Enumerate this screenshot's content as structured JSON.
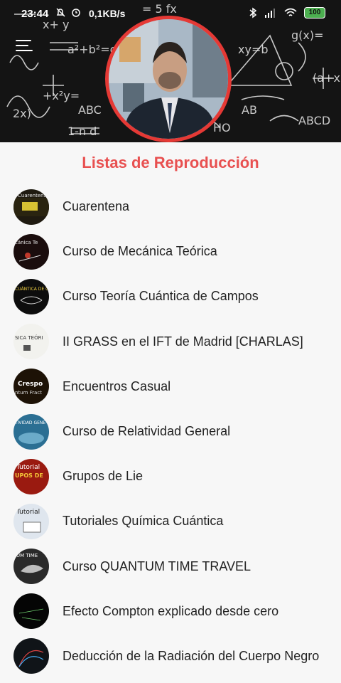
{
  "status_bar": {
    "time": "23:44",
    "speed": "0,1KB/s",
    "battery": "100",
    "icons": [
      "bell-off-icon",
      "alarm-icon",
      "bluetooth-icon",
      "signal-icon",
      "wifi-icon",
      "battery-icon"
    ]
  },
  "header": {
    "menu_icon": "hamburger-menu-icon",
    "avatar": "profile-photo"
  },
  "colors": {
    "accent": "#e85050",
    "ring": "#e53935",
    "background": "#f7f7f7"
  },
  "section_title": "Listas de Reproducción",
  "playlists": [
    {
      "label": "Cuarentena",
      "thumb_color": "#1f1a10"
    },
    {
      "label": "Curso de Mecánica Teórica",
      "thumb_color": "#1a0d0d"
    },
    {
      "label": "Curso Teoría Cuántica de Campos",
      "thumb_color": "#0d0d0d"
    },
    {
      "label": "II GRASS en el IFT de Madrid [CHARLAS]",
      "thumb_color": "#f2f2ee"
    },
    {
      "label": "Encuentros Casual",
      "thumb_color": "#1d1206"
    },
    {
      "label": "Curso de Relatividad General",
      "thumb_color": "#2b6f93"
    },
    {
      "label": "Grupos de Lie",
      "thumb_color": "#9a1a10"
    },
    {
      "label": "Tutoriales Química Cuántica",
      "thumb_color": "#dfe6ee"
    },
    {
      "label": "Curso QUANTUM TIME TRAVEL",
      "thumb_color": "#2a2a2a"
    },
    {
      "label": "Efecto Compton explicado desde cero",
      "thumb_color": "#050505"
    },
    {
      "label": "Deducción de la Radiación del Cuerpo Negro",
      "thumb_color": "#101418"
    }
  ],
  "thumb_texts": {
    "t1": "Cuarentena",
    "t2": "cánica Te",
    "t3": "CUÁNTICA DE C",
    "t4": "SICA TEÓRI",
    "t5": "Crespo",
    "t6": "ntum Fract",
    "t7": "TIVIDAD GENE",
    "t8": "Tutorial",
    "t9": "UPOS DE",
    "t10": "Tutorial",
    "t11": "UM TIME"
  }
}
